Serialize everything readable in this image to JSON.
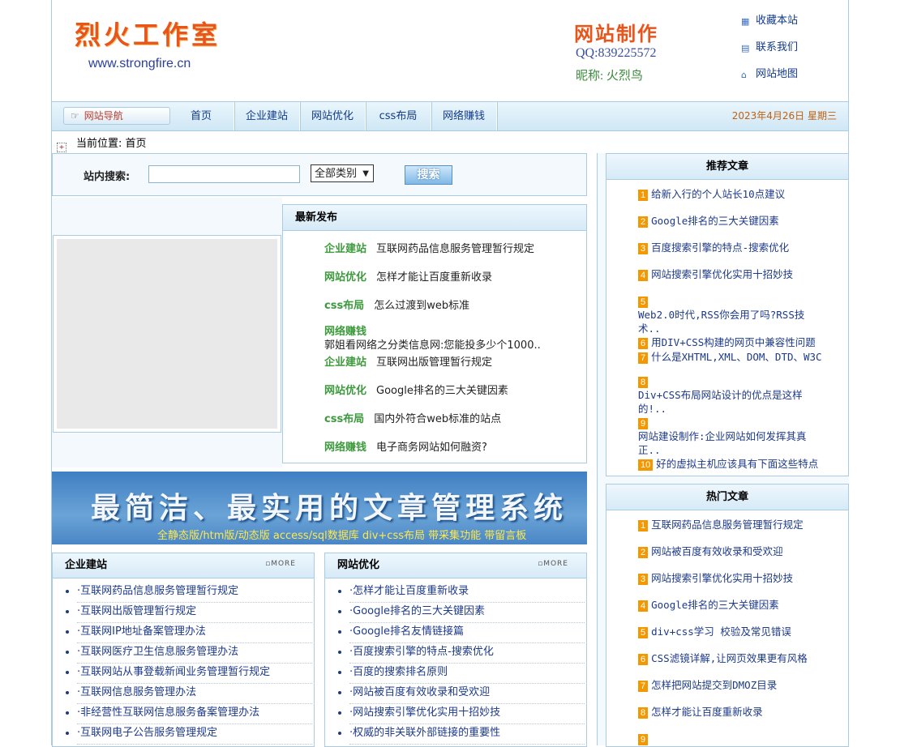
{
  "header": {
    "logo_title": "烈火工作室",
    "logo_url": "www.strongfire.cn",
    "ad_title": "网站制作",
    "ad_qq": "QQ:839225572",
    "ad_nick": "昵称: 火烈鸟",
    "links": [
      {
        "label": "收藏本站",
        "icon": "bookmark-icon"
      },
      {
        "label": "联系我们",
        "icon": "contact-icon"
      },
      {
        "label": "网站地图",
        "icon": "home-icon"
      }
    ]
  },
  "nav": {
    "label": "网站导航",
    "items": [
      "首页",
      "企业建站",
      "网站优化",
      "css布局",
      "网络赚钱"
    ],
    "date": "2023年4月26日  星期三"
  },
  "location": {
    "prefix": "当前位置:",
    "current": "首页"
  },
  "search": {
    "label": "站内搜索:",
    "value": "",
    "category": "全部类别",
    "button": "搜索"
  },
  "newest": {
    "title": "最新发布",
    "items": [
      {
        "cat": "企业建站",
        "title": "互联网药品信息服务管理暂行规定"
      },
      {
        "cat": "网站优化",
        "title": "怎样才能让百度重新收录"
      },
      {
        "cat": "css布局",
        "title": "怎么过渡到web标准"
      },
      {
        "cat": "网络赚钱",
        "title": "郭姐看网络之分类信息网:您能投多少个1000.."
      },
      {
        "cat": "企业建站",
        "title": "互联网出版管理暂行规定"
      },
      {
        "cat": "网站优化",
        "title": "Google排名的三大关键因素"
      },
      {
        "cat": "css布局",
        "title": "国内外符合web标准的站点"
      },
      {
        "cat": "网络赚钱",
        "title": "电子商务网站如何融资?"
      }
    ]
  },
  "banner": {
    "title": "最简洁、最实用的文章管理系统",
    "subtitle": "全静态版/htm版/动态版   access/sql数据库  div+css布局  带采集功能  带留言板"
  },
  "box_qiye": {
    "title": "企业建站",
    "more": "MORE",
    "items": [
      "互联网药品信息服务管理暂行规定",
      "互联网出版管理暂行规定",
      "互联网IP地址备案管理办法",
      "互联网医疗卫生信息服务管理办法",
      "互联网站从事登载新闻业务管理暂行规定",
      "互联网信息服务管理办法",
      "非经营性互联网信息服务备案管理办法",
      "互联网电子公告服务管理规定"
    ]
  },
  "box_youhua": {
    "title": "网站优化",
    "more": "MORE",
    "items": [
      "怎样才能让百度重新收录",
      "Google排名的三大关键因素",
      "Google排名友情链接篇",
      "百度搜索引擎的特点-搜索优化",
      "百度的搜索排名原则",
      "网站被百度有效收录和受欢迎",
      "网站搜索引擎优化实用十招妙技",
      "权威的非关联外部链接的重要性"
    ]
  },
  "recommend": {
    "title": "推荐文章",
    "items": [
      {
        "n": "1",
        "t": "给新入行的个人站长10点建议"
      },
      {
        "n": "2",
        "t": "Google排名的三大关键因素"
      },
      {
        "n": "3",
        "t": "百度搜索引擎的特点-搜索优化"
      },
      {
        "n": "4",
        "t": "网站搜索引擎优化实用十招妙技"
      },
      {
        "n": "5",
        "t": "Web2.0时代,RSS你会用了吗?RSS技术.."
      },
      {
        "n": "6",
        "t": "用DIV+CSS构建的网页中兼容性问题"
      },
      {
        "n": "7",
        "t": "什么是XHTML,XML、DOM、DTD、W3C"
      },
      {
        "n": "8",
        "t": "Div+CSS布局网站设计的优点是这样的!.."
      },
      {
        "n": "9",
        "t": "网站建设制作:企业网站如何发挥其真正.."
      },
      {
        "n": "10",
        "t": "好的虚拟主机应该具有下面这些特点"
      }
    ]
  },
  "hot": {
    "title": "热门文章",
    "items": [
      {
        "n": "1",
        "t": "互联网药品信息服务管理暂行规定"
      },
      {
        "n": "2",
        "t": "网站被百度有效收录和受欢迎"
      },
      {
        "n": "3",
        "t": "网站搜索引擎优化实用十招妙技"
      },
      {
        "n": "4",
        "t": "Google排名的三大关键因素"
      },
      {
        "n": "5",
        "t": "div+css学习  校验及常见错误"
      },
      {
        "n": "6",
        "t": "CSS滤镜详解,让网页效果更有风格"
      },
      {
        "n": "7",
        "t": "怎样把网站提交到DMOZ目录"
      },
      {
        "n": "8",
        "t": "怎样才能让百度重新收录"
      },
      {
        "n": "9",
        "t": ""
      }
    ]
  }
}
